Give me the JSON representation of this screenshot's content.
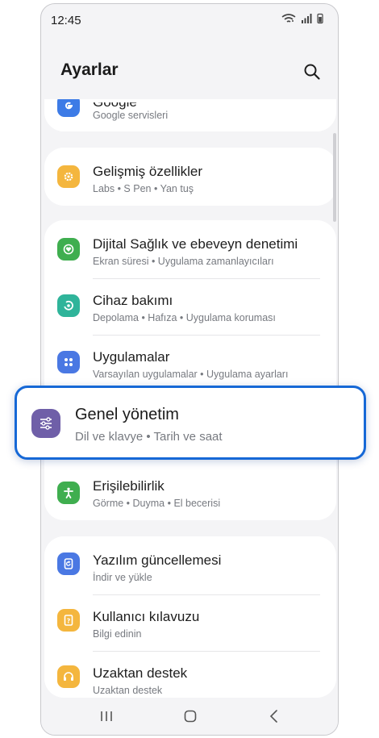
{
  "status_bar": {
    "time": "12:45"
  },
  "header": {
    "title": "Ayarlar"
  },
  "cards": {
    "google": {
      "label": "Google",
      "sub": "Google servisleri"
    },
    "advanced": {
      "label": "Gelişmiş özellikler",
      "sub": "Labs  •  S Pen  •  Yan tuş"
    },
    "digital": {
      "label": "Dijital Sağlık ve ebeveyn denetimi",
      "sub": "Ekran süresi  •  Uygulama zamanlayıcıları"
    },
    "device": {
      "label": "Cihaz bakımı",
      "sub": "Depolama  •  Hafıza  •  Uygulama koruması"
    },
    "apps": {
      "label": "Uygulamalar",
      "sub": "Varsayılan uygulamalar  •  Uygulama ayarları"
    },
    "accessibility": {
      "label": "Erişilebilirlik",
      "sub": "Görme  •  Duyma  •  El becerisi"
    },
    "software": {
      "label": "Yazılım güncellemesi",
      "sub": "İndir ve yükle"
    },
    "manual": {
      "label": "Kullanıcı kılavuzu",
      "sub": "Bilgi edinin"
    },
    "remote": {
      "label": "Uzaktan destek",
      "sub": "Uzaktan destek"
    }
  },
  "highlight": {
    "label": "Genel yönetim",
    "sub": "Dil ve klavye  •  Tarih ve saat"
  },
  "colors": {
    "google_icon": "#3d7be6",
    "advanced_icon": "#f4b63e",
    "digital_icon": "#3fae4f",
    "device_icon": "#2fb49a",
    "apps_icon": "#4a78e3",
    "accessibility_icon": "#3fae4f",
    "software_icon": "#4a78e3",
    "manual_icon": "#f4b63e",
    "remote_icon": "#f4b63e",
    "highlight_icon": "#6f5fa8",
    "highlight_border": "#1668d6"
  }
}
